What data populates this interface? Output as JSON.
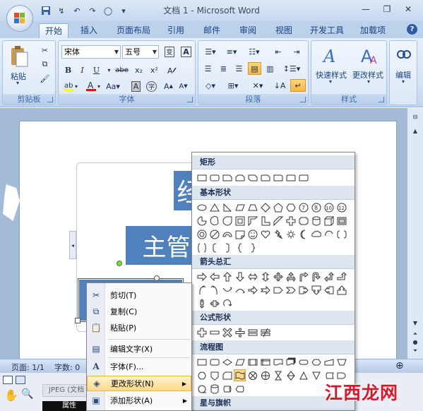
{
  "titlebar": {
    "title": "文档 1 - Microsoft Word"
  },
  "tabs": [
    "开始",
    "插入",
    "页面布局",
    "引用",
    "邮件",
    "审阅",
    "视图",
    "开发工具",
    "加载项"
  ],
  "ribbon": {
    "clipboard": {
      "paste_label": "粘贴",
      "group_label": "剪贴板"
    },
    "font": {
      "font_name": "宋体",
      "font_size": "五号",
      "group_label": "字体"
    },
    "paragraph": {
      "group_label": "段落"
    },
    "styles": {
      "quick_styles": "快速样式",
      "change_styles": "更改样式",
      "group_label": "样式"
    },
    "editing": {
      "label": "编辑"
    }
  },
  "document": {
    "shape_title": "主管",
    "shape_top_char": "经"
  },
  "statusbar": {
    "page": "页面: 1/1",
    "words": "字数: 0"
  },
  "bottom": {
    "jpeg_label": "JPEG (文档",
    "props_label": "属性"
  },
  "context_menu": {
    "items": [
      {
        "label": "剪切(T)",
        "icon": "scissors-icon"
      },
      {
        "label": "复制(C)",
        "icon": "copy-icon"
      },
      {
        "label": "粘贴(P)",
        "icon": "paste-icon"
      },
      {
        "label": "编辑文字(X)",
        "icon": "edit-text-icon"
      },
      {
        "label": "字体(F)...",
        "icon": "font-icon"
      },
      {
        "label": "更改形状(N)",
        "icon": "change-shape-icon",
        "highlighted": true
      },
      {
        "label": "添加形状(A)",
        "icon": "add-shape-icon"
      }
    ]
  },
  "gallery": {
    "sections": [
      "矩形",
      "基本形状",
      "箭头总汇",
      "公式形状",
      "流程图",
      "星与旗帜"
    ]
  },
  "watermark": {
    "text": "江西龙网"
  }
}
